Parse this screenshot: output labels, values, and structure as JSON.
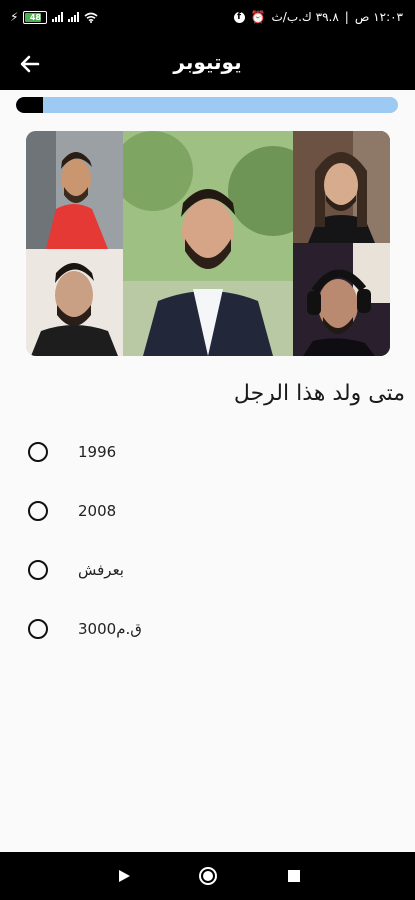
{
  "status_bar": {
    "time": "١٢:٠٣ ص",
    "speed": "٣٩.٨ ك.ب/ث",
    "battery": "48",
    "colors": {
      "battery_fill": "#4caf50"
    }
  },
  "app_bar": {
    "title": "يوتيوبر",
    "back_icon": "arrow-left-icon"
  },
  "progress": {
    "fraction": 0.07,
    "track_color": "#9ccaf2",
    "fill_color": "#000000"
  },
  "question": {
    "text": "متى ولد هذا الرجل"
  },
  "options": [
    {
      "label": "1996"
    },
    {
      "label": "2008"
    },
    {
      "label": "بعرفش"
    },
    {
      "label": "3000ق.م"
    }
  ],
  "nav": {
    "back_icon": "triangle-back-icon",
    "home_icon": "circle-home-icon",
    "recents_icon": "square-recents-icon"
  }
}
